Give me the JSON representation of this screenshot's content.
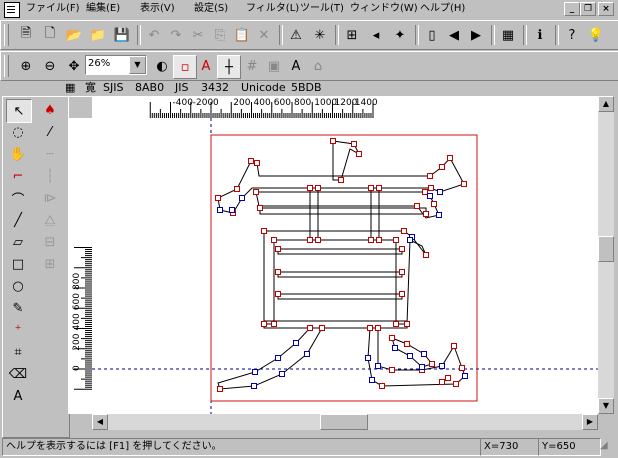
{
  "menubar": {
    "items": [
      "ファイル(F)",
      "編集(E)",
      "表示(V)",
      "設定(S)",
      "フィルタ(L)",
      "ツール(T)",
      "ウィンドウ(W)",
      "ヘルプ(H)"
    ]
  },
  "zoom": {
    "value": "26%"
  },
  "info": {
    "glyph": "寛",
    "sjis_label": "SJIS",
    "sjis": "8AB0",
    "jis_label": "JIS",
    "jis": "3432",
    "unicode_label": "Unicode",
    "unicode": "5BDB"
  },
  "ruler_top": [
    "-400",
    "-200",
    "0",
    "200",
    "400",
    "600",
    "800",
    "1000",
    "1200",
    "1400"
  ],
  "ruler_left": [
    "800",
    "600",
    "400",
    "200",
    "0"
  ],
  "status": {
    "help": "ヘルプを表示するには [F1] を押してください。",
    "x": "X=730",
    "y": "Y=650"
  },
  "colors": {
    "outline": "#d01010",
    "node": "#c00000",
    "offnode": "#0000b0",
    "guide": "#000080"
  }
}
